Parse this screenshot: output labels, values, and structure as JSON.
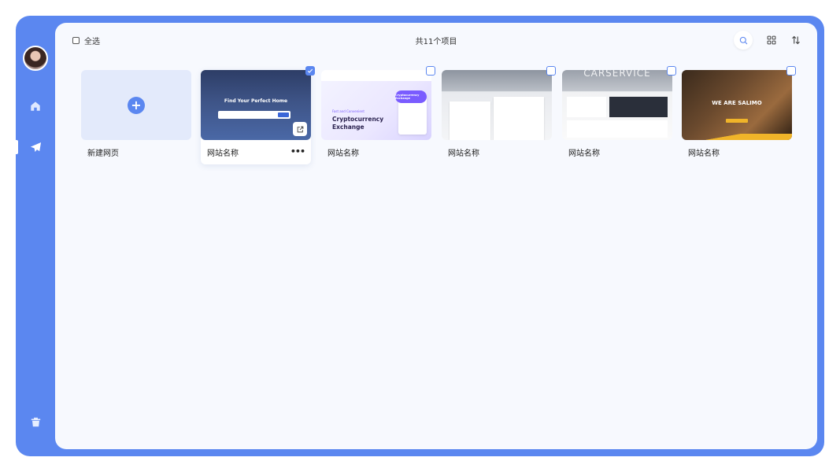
{
  "sidebar": {
    "icons": [
      "home-icon",
      "send-icon",
      "trash-icon"
    ]
  },
  "toolbar": {
    "select_all_label": "全选",
    "item_count": "共11个项目",
    "icons": [
      "search-icon",
      "grid-view-icon",
      "sort-icon"
    ]
  },
  "new_page": {
    "label": "新建网页"
  },
  "cards": [
    {
      "name": "网站名称",
      "selected": true,
      "hero_text": "Find Your Perfect Home"
    },
    {
      "name": "网站名称",
      "selected": false,
      "subtitle": "Fast and Convenient",
      "hero_text": "Cryptocurrency Exchange",
      "badge": "Cryptocurrency Exchange"
    },
    {
      "name": "网站名称",
      "selected": false
    },
    {
      "name": "网站名称",
      "selected": false,
      "hero_text": "CARSERVICE"
    },
    {
      "name": "网站名称",
      "selected": false,
      "hero_text": "WE ARE SALIMO"
    }
  ],
  "colors": {
    "accent": "#5b87f0",
    "panel_bg": "#f7f9fe",
    "new_tile_bg": "#e3eafb"
  }
}
